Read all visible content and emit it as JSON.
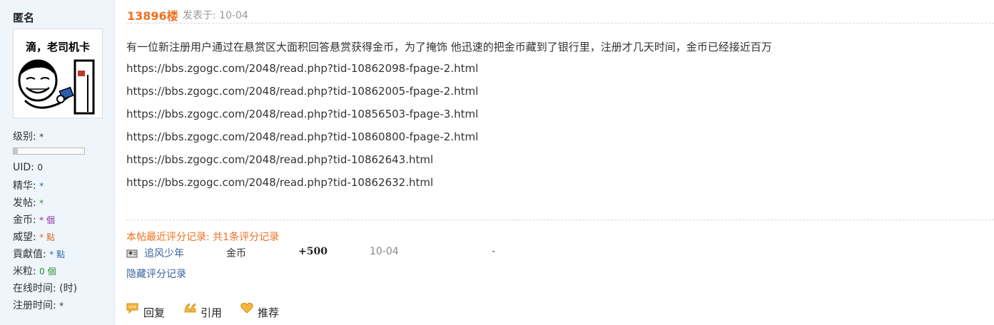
{
  "user": {
    "name": "匿名",
    "avatar_caption": "滴，老司机卡",
    "stats": [
      {
        "label": "级别: ",
        "value": "*",
        "unit": ""
      },
      {
        "label": "UID: ",
        "value": "0",
        "unit": ""
      },
      {
        "label": "精华: ",
        "value": "*",
        "unit": ""
      },
      {
        "label": "发帖: ",
        "value": "*",
        "unit": ""
      },
      {
        "label": "金币: ",
        "value": "*",
        "unit": " 個"
      },
      {
        "label": "威望: ",
        "value": "*",
        "unit": " 點"
      },
      {
        "label": "貢獻值: ",
        "value": "*",
        "unit": " 點"
      },
      {
        "label": "米粒: ",
        "value": "0",
        "unit": " 個"
      },
      {
        "label": "在线时间: ",
        "value": "(时)",
        "unit": ""
      },
      {
        "label": "注册时间: ",
        "value": "*",
        "unit": ""
      }
    ],
    "level_progress": 0.06
  },
  "post": {
    "floor": "13896楼",
    "posted": "发表于: 10-04",
    "lines": [
      "有一位新注册用户通过在悬赏区大面积回答悬赏获得金币，为了掩饰 他迅速的把金币藏到了银行里，注册才几天时间，金币已经接近百万",
      "https://bbs.zgogc.com/2048/read.php?tid-10862098-fpage-2.html",
      "https://bbs.zgogc.com/2048/read.php?tid-10862005-fpage-2.html",
      "https://bbs.zgogc.com/2048/read.php?tid-10856503-fpage-3.html",
      "https://bbs.zgogc.com/2048/read.php?tid-10860800-fpage-2.html",
      "https://bbs.zgogc.com/2048/read.php?tid-10862643.html",
      "https://bbs.zgogc.com/2048/read.php?tid-10862632.html"
    ]
  },
  "rating": {
    "title": "本帖最近评分记录: 共1条评分记录",
    "records": [
      {
        "user": "追风少年",
        "type": "金币",
        "amount": "+500",
        "date": "10-04",
        "reason": "-"
      }
    ],
    "hide_label": "隐藏评分记录"
  },
  "actions": {
    "reply": "回复",
    "quote": "引用",
    "recommend": "推荐"
  },
  "colors": {
    "sidebar_bg": "#eef5fb",
    "accent_orange": "#f07020",
    "link_blue": "#3a64a0"
  }
}
